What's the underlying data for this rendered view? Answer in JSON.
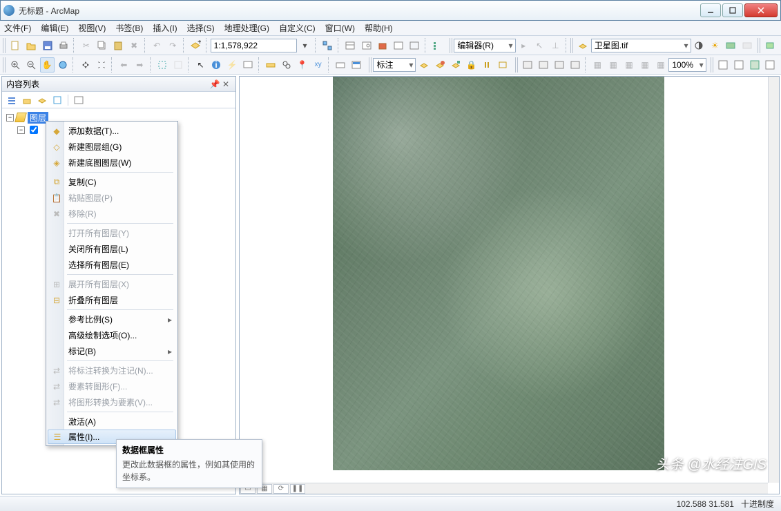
{
  "window": {
    "title": "无标题 - ArcMap"
  },
  "menus": [
    "文件(F)",
    "编辑(E)",
    "视图(V)",
    "书签(B)",
    "插入(I)",
    "选择(S)",
    "地理处理(G)",
    "自定义(C)",
    "窗口(W)",
    "帮助(H)"
  ],
  "toolbar": {
    "scale": "1:1,578,922",
    "editor_label": "编辑器(R)",
    "anno_label": "标注",
    "layer_combo": "卫星图.tif",
    "zoom_pct": "100%"
  },
  "toc": {
    "title": "内容列表",
    "root": "图层"
  },
  "context_menu": {
    "items": [
      {
        "label": "添加数据(T)...",
        "icon": "add-data-icon"
      },
      {
        "label": "新建图层组(G)",
        "icon": "layer-group-icon"
      },
      {
        "label": "新建底图图层(W)",
        "icon": "basemap-icon"
      },
      {
        "sep": true
      },
      {
        "label": "复制(C)",
        "icon": "copy-icon"
      },
      {
        "label": "粘贴图层(P)",
        "icon": "paste-icon",
        "disabled": true
      },
      {
        "label": "移除(R)",
        "icon": "remove-icon",
        "disabled": true
      },
      {
        "sep": true
      },
      {
        "label": "打开所有图层(Y)",
        "disabled": true
      },
      {
        "label": "关闭所有图层(L)"
      },
      {
        "label": "选择所有图层(E)"
      },
      {
        "sep": true
      },
      {
        "label": "展开所有图层(X)",
        "icon": "expand-icon",
        "disabled": true
      },
      {
        "label": "折叠所有图层",
        "icon": "collapse-icon"
      },
      {
        "sep": true
      },
      {
        "label": "参考比例(S)",
        "sub": true
      },
      {
        "label": "高级绘制选项(O)..."
      },
      {
        "label": "标记(B)",
        "sub": true
      },
      {
        "sep": true
      },
      {
        "label": "将标注转换为注记(N)...",
        "icon": "convert-anno-icon",
        "disabled": true
      },
      {
        "label": "要素转图形(F)...",
        "icon": "feat-to-graphic-icon",
        "disabled": true
      },
      {
        "label": "将图形转换为要素(V)...",
        "icon": "graphic-to-feat-icon",
        "disabled": true
      },
      {
        "sep": true
      },
      {
        "label": "激活(A)"
      },
      {
        "label": "属性(I)...",
        "icon": "properties-icon",
        "highlight": true
      }
    ]
  },
  "tooltip": {
    "title": "数据框属性",
    "body": "更改此数据框的属性，例如其使用的坐标系。"
  },
  "status": {
    "coords": "102.588  31.581",
    "unit": "十进制度"
  },
  "watermark": "头条 @水经注GIS"
}
